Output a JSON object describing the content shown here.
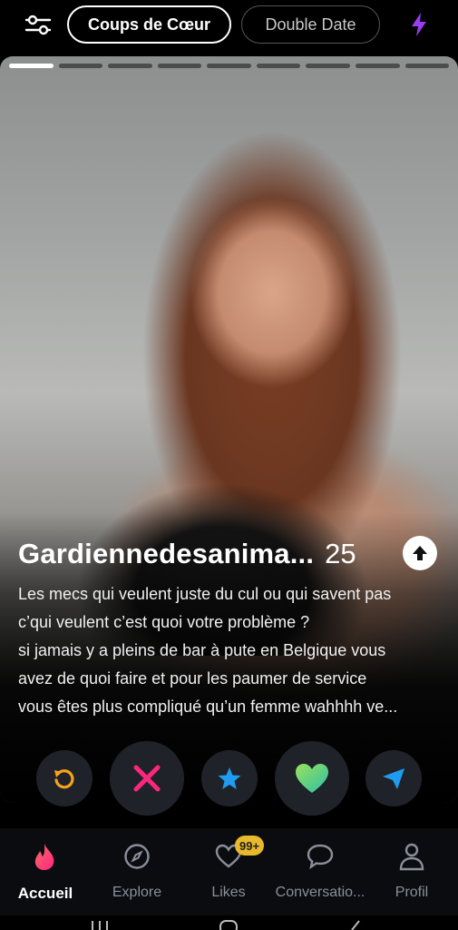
{
  "header": {
    "tab_active": "Coups de Cœur",
    "tab_inactive": "Double Date"
  },
  "card": {
    "photo_count": 9,
    "current_photo": 1,
    "name": "Gardiennedesanima...",
    "age": "25",
    "bio_lines": [
      "Les mecs qui veulent juste du cul ou qui savent pas",
      "c’qui veulent c’est quoi votre problème ?",
      "si jamais y a pleins de bar à pute en Belgique vous",
      "avez de quoi faire et pour les paumer de service",
      "vous êtes plus compliqué qu’un femme wahhhh ve..."
    ]
  },
  "actions": {
    "rewind_icon": "rewind-icon",
    "nope_icon": "x-icon",
    "super_like_icon": "star-icon",
    "like_icon": "heart-icon",
    "boost_icon": "send-icon",
    "colors": {
      "rewind": "#f7a21b",
      "nope": "#fd267d",
      "super_like": "#1e9cf0",
      "like": "#52d46a",
      "send": "#1e9cf0"
    }
  },
  "nav": {
    "home": "Accueil",
    "explore": "Explore",
    "likes": "Likes",
    "likes_badge": "99+",
    "messages": "Conversatio...",
    "profile": "Profil"
  }
}
